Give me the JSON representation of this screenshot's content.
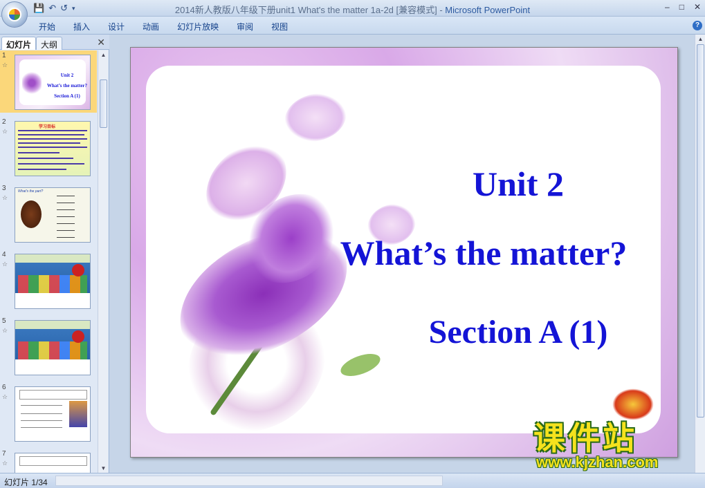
{
  "window": {
    "title_doc": "2014新人教版八年级下册unit1 What's the matter  1a-2d [兼容模式] - ",
    "title_app": "Microsoft PowerPoint",
    "controls": [
      "–",
      "□",
      "✕"
    ]
  },
  "quick_access": {
    "save_icon": "save-icon",
    "undo_icon": "undo-icon",
    "redo_icon": "redo-icon"
  },
  "ribbon": {
    "tabs": [
      "开始",
      "插入",
      "设计",
      "动画",
      "幻灯片放映",
      "审阅",
      "视图"
    ]
  },
  "left_pane": {
    "tab_slides": "幻灯片",
    "tab_outline": "大纲",
    "close": "✕",
    "slides": [
      {
        "number": "1",
        "title_lines": [
          "Unit 2",
          "What’s the matter?",
          "Section A (1)"
        ]
      },
      {
        "number": "2",
        "header": "学习目标"
      },
      {
        "number": "3",
        "header": "What's the part?"
      },
      {
        "number": "4"
      },
      {
        "number": "5"
      },
      {
        "number": "6"
      },
      {
        "number": "7"
      }
    ]
  },
  "slide": {
    "line1": "Unit 2",
    "line2": "What’s the matter?",
    "line3": "Section A (1)"
  },
  "watermark": {
    "cn": "课件站",
    "url": "www.kjzhan.com"
  },
  "status": {
    "slide_counter": "幻灯片 1/34"
  }
}
